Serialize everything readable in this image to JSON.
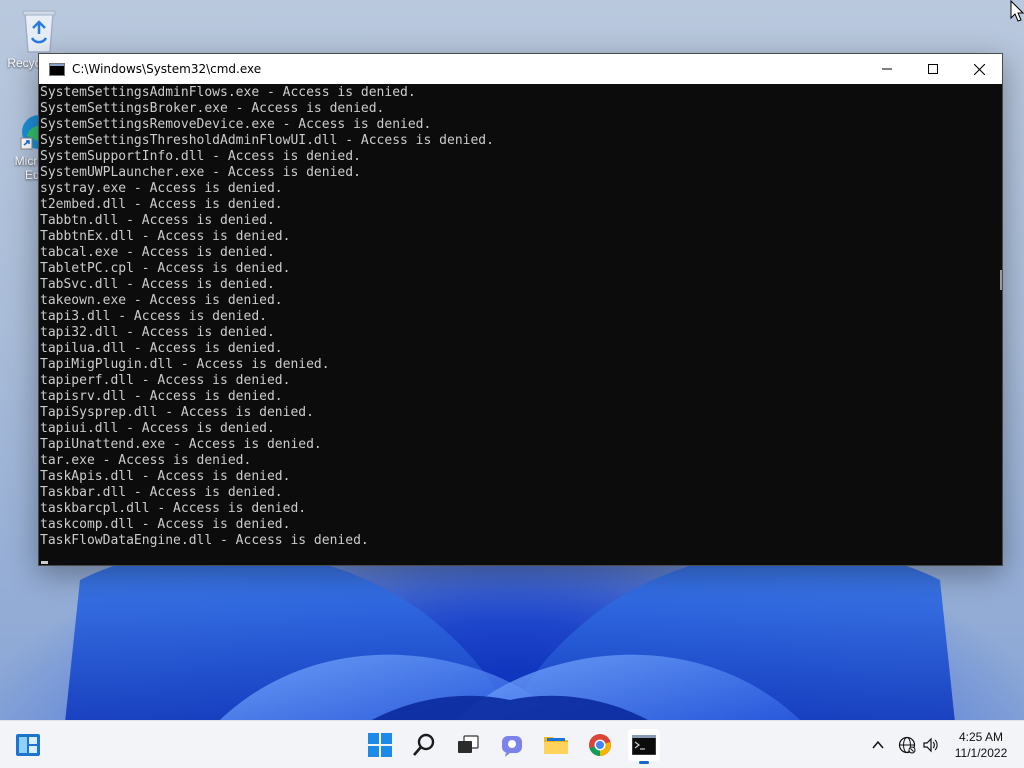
{
  "desktop": {
    "icons": [
      {
        "label": "Recycle Bin",
        "icon": "recycle-bin-icon"
      },
      {
        "label": "Microsoft Edge",
        "icon": "edge-icon"
      }
    ]
  },
  "window": {
    "title": "C:\\Windows\\System32\\cmd.exe",
    "buttons": {
      "minimize": "minimize-icon",
      "maximize": "maximize-icon",
      "close": "close-icon"
    }
  },
  "console": {
    "lines": [
      "SystemSettingsAdminFlows.exe - Access is denied.",
      "SystemSettingsBroker.exe - Access is denied.",
      "SystemSettingsRemoveDevice.exe - Access is denied.",
      "SystemSettingsThresholdAdminFlowUI.dll - Access is denied.",
      "SystemSupportInfo.dll - Access is denied.",
      "SystemUWPLauncher.exe - Access is denied.",
      "systray.exe - Access is denied.",
      "t2embed.dll - Access is denied.",
      "Tabbtn.dll - Access is denied.",
      "TabbtnEx.dll - Access is denied.",
      "tabcal.exe - Access is denied.",
      "TabletPC.cpl - Access is denied.",
      "TabSvc.dll - Access is denied.",
      "takeown.exe - Access is denied.",
      "tapi3.dll - Access is denied.",
      "tapi32.dll - Access is denied.",
      "tapilua.dll - Access is denied.",
      "TapiMigPlugin.dll - Access is denied.",
      "tapiperf.dll - Access is denied.",
      "tapisrv.dll - Access is denied.",
      "TapiSysprep.dll - Access is denied.",
      "tapiui.dll - Access is denied.",
      "TapiUnattend.exe - Access is denied.",
      "tar.exe - Access is denied.",
      "TaskApis.dll - Access is denied.",
      "Taskbar.dll - Access is denied.",
      "taskbarcpl.dll - Access is denied.",
      "taskcomp.dll - Access is denied.",
      "TaskFlowDataEngine.dll - Access is denied."
    ]
  },
  "taskbar": {
    "pinned": [
      "widgets-icon",
      "start-icon",
      "search-icon",
      "task-view-icon",
      "chat-icon",
      "file-explorer-icon",
      "chrome-icon",
      "terminal-icon"
    ],
    "tray": [
      "chevron-up-icon",
      "network-icon",
      "volume-icon"
    ],
    "clock": {
      "time": "4:25 AM",
      "date": "11/1/2022"
    }
  }
}
